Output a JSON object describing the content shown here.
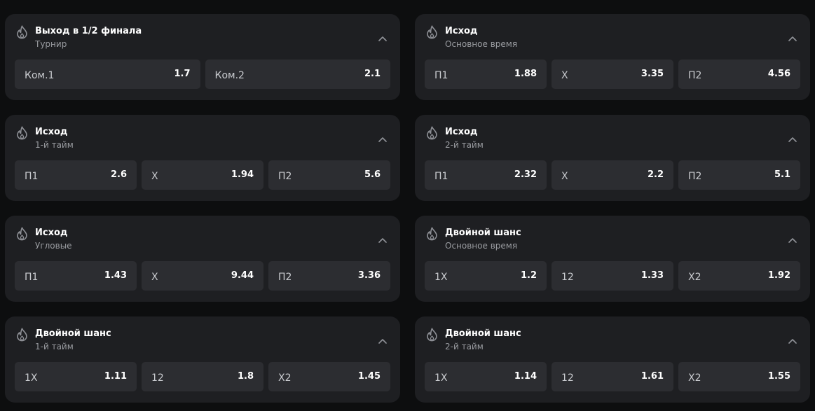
{
  "markets": [
    {
      "title": "Выход в 1/2 финала",
      "subtitle": "Турнир",
      "icon": "fire-icon",
      "outcomes": [
        {
          "label": "Ком.1",
          "odds": "1.7"
        },
        {
          "label": "Ком.2",
          "odds": "2.1"
        }
      ]
    },
    {
      "title": "Исход",
      "subtitle": "Основное время",
      "icon": "fire-icon",
      "outcomes": [
        {
          "label": "П1",
          "odds": "1.88"
        },
        {
          "label": "Х",
          "odds": "3.35"
        },
        {
          "label": "П2",
          "odds": "4.56"
        }
      ]
    },
    {
      "title": "Исход",
      "subtitle": "1-й тайм",
      "icon": "fire-icon",
      "outcomes": [
        {
          "label": "П1",
          "odds": "2.6"
        },
        {
          "label": "Х",
          "odds": "1.94"
        },
        {
          "label": "П2",
          "odds": "5.6"
        }
      ]
    },
    {
      "title": "Исход",
      "subtitle": "2-й тайм",
      "icon": "fire-icon",
      "outcomes": [
        {
          "label": "П1",
          "odds": "2.32"
        },
        {
          "label": "Х",
          "odds": "2.2"
        },
        {
          "label": "П2",
          "odds": "5.1"
        }
      ]
    },
    {
      "title": "Исход",
      "subtitle": "Угловые",
      "icon": "fire-icon",
      "outcomes": [
        {
          "label": "П1",
          "odds": "1.43"
        },
        {
          "label": "Х",
          "odds": "9.44"
        },
        {
          "label": "П2",
          "odds": "3.36"
        }
      ]
    },
    {
      "title": "Двойной шанс",
      "subtitle": "Основное время",
      "icon": "fire-icon",
      "outcomes": [
        {
          "label": "1Х",
          "odds": "1.2"
        },
        {
          "label": "12",
          "odds": "1.33"
        },
        {
          "label": "Х2",
          "odds": "1.92"
        }
      ]
    },
    {
      "title": "Двойной шанс",
      "subtitle": "1-й тайм",
      "icon": "fire-icon",
      "outcomes": [
        {
          "label": "1Х",
          "odds": "1.11"
        },
        {
          "label": "12",
          "odds": "1.8"
        },
        {
          "label": "Х2",
          "odds": "1.45"
        }
      ]
    },
    {
      "title": "Двойной шанс",
      "subtitle": "2-й тайм",
      "icon": "fire-icon",
      "outcomes": [
        {
          "label": "1Х",
          "odds": "1.14"
        },
        {
          "label": "12",
          "odds": "1.61"
        },
        {
          "label": "Х2",
          "odds": "1.55"
        }
      ]
    }
  ],
  "colors": {
    "page_bg": "#0d0e0f",
    "card_bg": "#1e1f22",
    "button_bg": "#2c2d31",
    "title_text": "#ffffff",
    "subtitle_text": "#9a9ca1",
    "icon_color": "#8e9096"
  }
}
